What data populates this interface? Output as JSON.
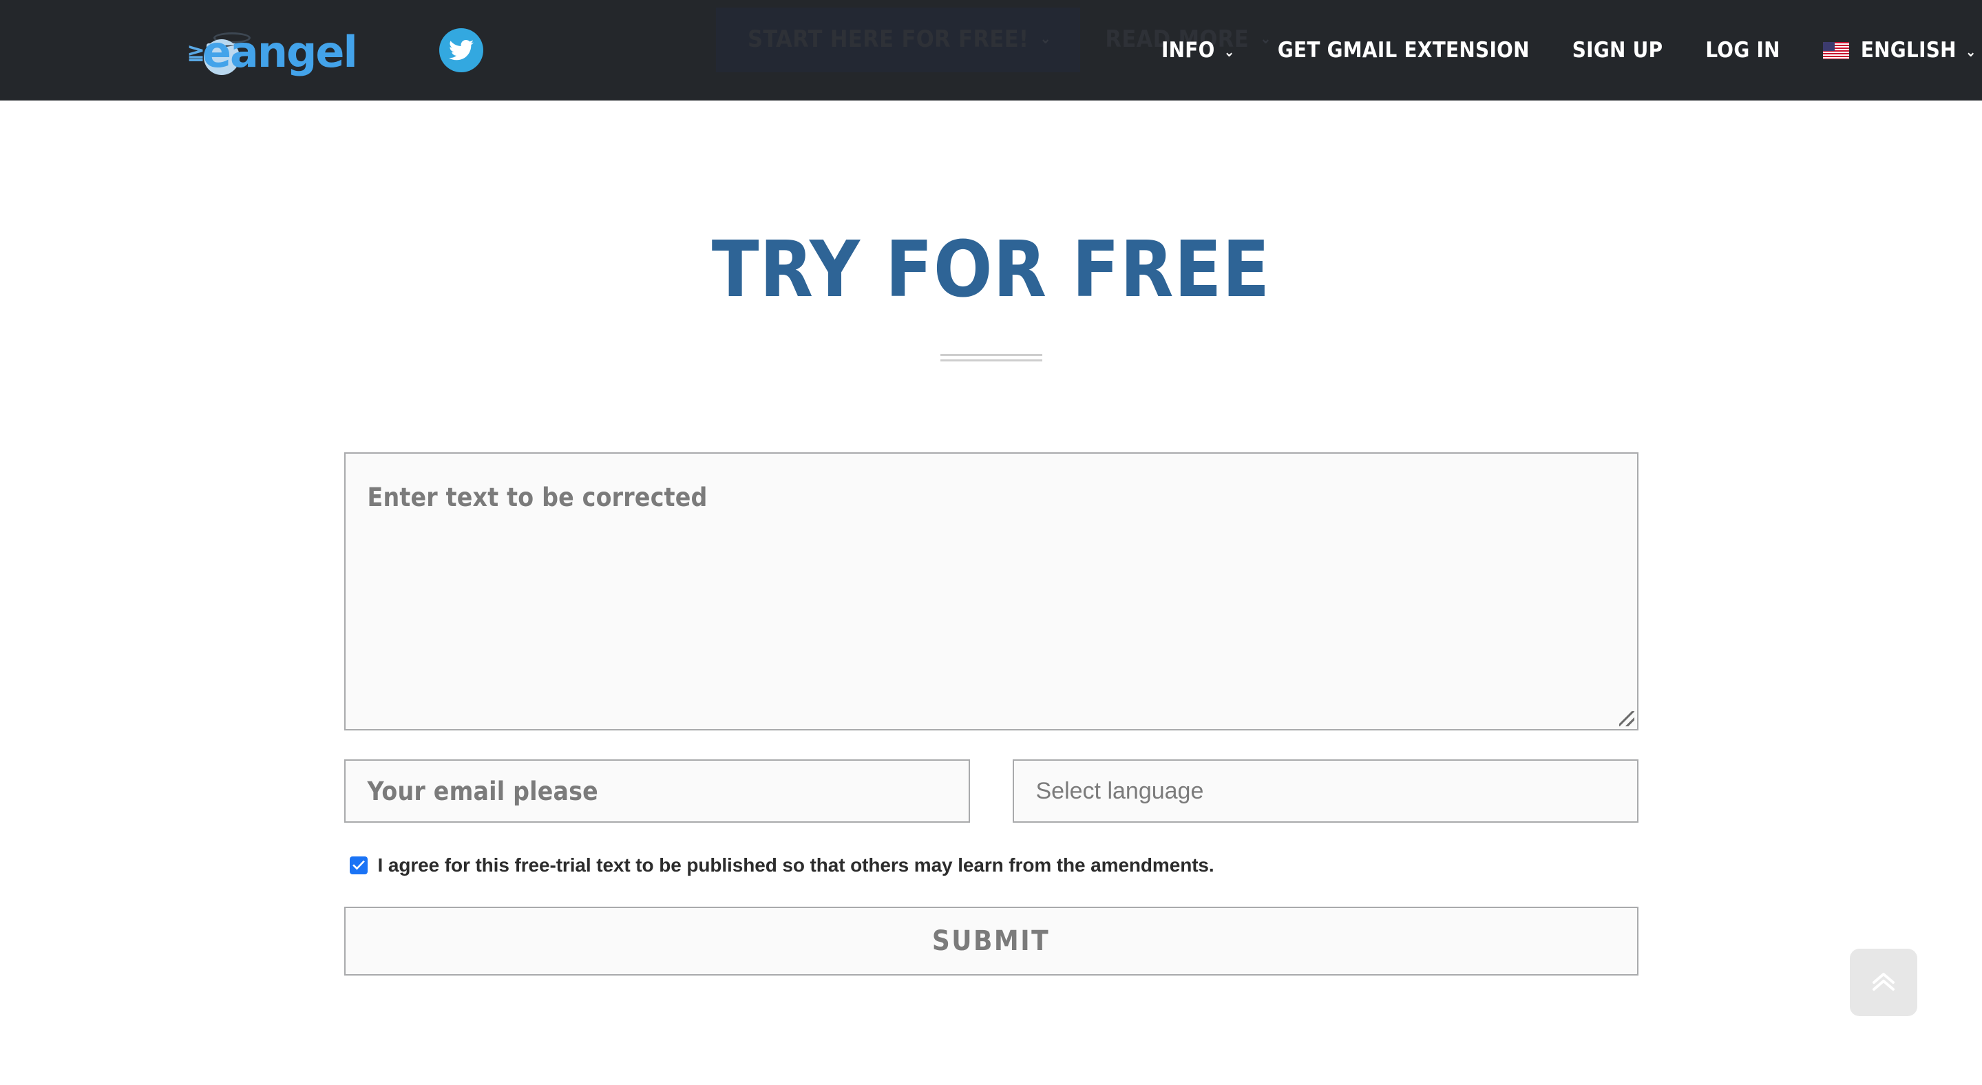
{
  "header": {
    "brand": {
      "logo_text": "eangel",
      "logo_icon": "angel-envelope-logo",
      "social_icon": "twitter-icon"
    },
    "faded_nav": [
      {
        "label": "START HERE FOR FREE!",
        "has_chevron": true,
        "chevron": "⌄",
        "state": "panel-open"
      },
      {
        "label": "READ MORE",
        "has_chevron": true,
        "chevron": "⌄",
        "state": "faded"
      }
    ],
    "nav": [
      {
        "label": "INFO",
        "has_chevron": true,
        "chevron": "⌄",
        "icon": "chevron-down-icon"
      },
      {
        "label": "GET GMAIL EXTENSION",
        "has_chevron": false
      },
      {
        "label": "SIGN UP",
        "has_chevron": false
      },
      {
        "label": "LOG IN",
        "has_chevron": false
      },
      {
        "label": "ENGLISH",
        "has_chevron": true,
        "chevron": "⌄",
        "icon": "us-flag-icon"
      }
    ],
    "bg_color": "#24272b",
    "text_color": "#ffffff"
  },
  "main": {
    "title": "TRY FOR FREE",
    "title_color": "#2e6496",
    "divider": "double-rule-divider",
    "form": {
      "textarea": {
        "placeholder": "Enter text to be corrected",
        "value": ""
      },
      "email": {
        "placeholder": "Your email please",
        "value": ""
      },
      "language": {
        "placeholder": "Select language",
        "value": ""
      },
      "agree": {
        "label": "I agree for this free-trial text to be published so that others may learn from the amendments.",
        "checked": true,
        "check_color": "#1a73f5"
      },
      "submit_label": "SUBMIT"
    }
  },
  "widgets": {
    "scroll_top": {
      "icon": "double-chevron-up-icon",
      "bg_color": "#e7e7e7"
    }
  }
}
